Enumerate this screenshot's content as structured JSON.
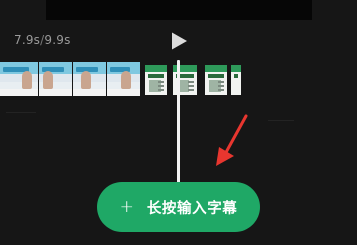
{
  "player": {
    "current_time": "7.9s",
    "separator": "/",
    "total_time": "9.9s",
    "play_icon": "play-icon"
  },
  "timeline": {
    "playhead": "vertical-playhead"
  },
  "caption_button": {
    "plus_symbol": "+",
    "label": "长按输入字幕",
    "color": "#1fa866"
  },
  "annotation": {
    "arrow_color": "#e8362f"
  }
}
